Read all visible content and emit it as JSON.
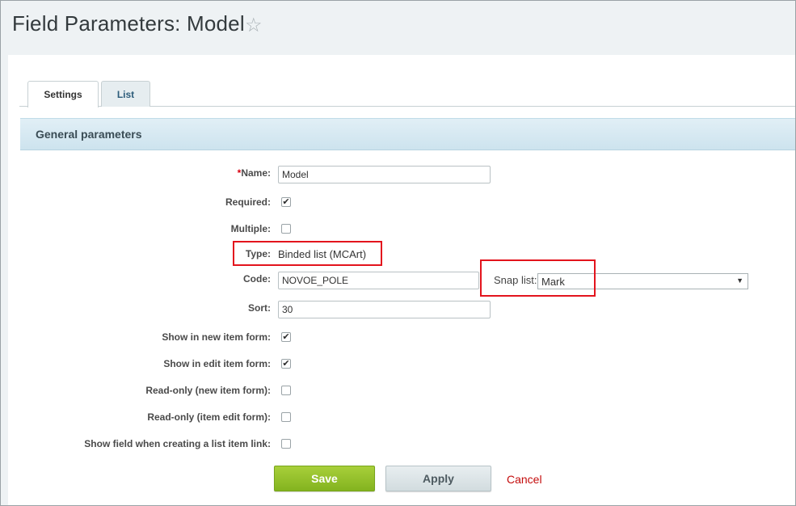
{
  "header": {
    "title": "Field Parameters: Model",
    "favorite_icon": "star-icon"
  },
  "tabs": [
    {
      "label": "Settings",
      "active": true
    },
    {
      "label": "List",
      "active": false
    }
  ],
  "section": {
    "title": "General parameters"
  },
  "form": {
    "name": {
      "required_mark": "*",
      "label": "Name:",
      "value": "Model"
    },
    "required": {
      "label": "Required:",
      "checked": true
    },
    "multiple": {
      "label": "Multiple:",
      "checked": false
    },
    "type": {
      "label": "Type:",
      "value": "Binded list (MCArt)"
    },
    "code": {
      "label": "Code:",
      "value": "NOVOE_POLE"
    },
    "snap_list": {
      "label": "Snap list:",
      "selected": "Mark"
    },
    "sort": {
      "label": "Sort:",
      "value": "30"
    },
    "show_in_new": {
      "label": "Show in new item form:",
      "checked": true
    },
    "show_in_edit": {
      "label": "Show in edit item form:",
      "checked": true
    },
    "readonly_new": {
      "label": "Read-only (new item form):",
      "checked": false
    },
    "readonly_edit": {
      "label": "Read-only (item edit form):",
      "checked": false
    },
    "show_field_link": {
      "label": "Show field when creating a list item link:",
      "checked": false
    }
  },
  "buttons": {
    "save": "Save",
    "apply": "Apply",
    "cancel": "Cancel"
  },
  "colors": {
    "highlight": "#e3141d",
    "save_green": "#8bbb22",
    "cancel_red": "#c40c0c"
  }
}
